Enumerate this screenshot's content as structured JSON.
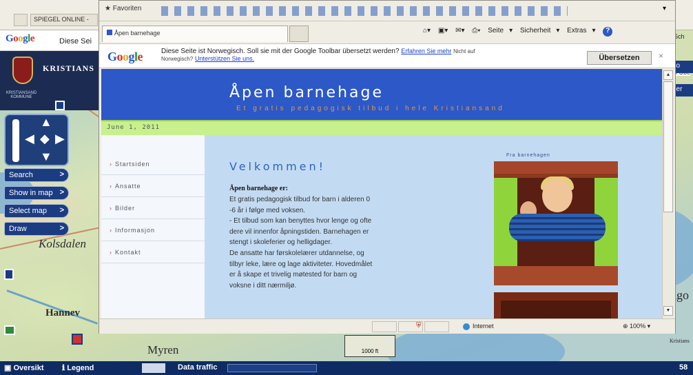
{
  "map_app": {
    "browser_tab_label": "SPIEGEL ONLINE -",
    "google_logo": "Google",
    "google_bar_text": "Diese Sei",
    "municipality_name": "KRISTIANS",
    "municipality_sub": "KRISTIANSAND KOMMUNE",
    "buttons": [
      {
        "label": "Search"
      },
      {
        "label": "Show in map"
      },
      {
        "label": "Select map"
      },
      {
        "label": "Draw"
      }
    ],
    "map_labels": {
      "kolsdalen": "Kolsdalen",
      "hannev": "Hannev",
      "myren": "Myren",
      "scale": "1000 ft",
      "right_lo": "Lo",
      "right_der": "der",
      "right_uber": "h Übe",
      "right_sch": "Sch",
      "right_krista": "Kristians",
      "right_ago": "ago"
    },
    "taskbar": {
      "oversikt": "Oversikt",
      "legend": "Legend",
      "data_traffic": "Data traffic",
      "right_num": "58"
    }
  },
  "popup": {
    "toolbar": {
      "favorites": "Favoriten"
    },
    "tab_title": "Åpen barnehage",
    "commands": {
      "page": "Seite",
      "security": "Sicherheit",
      "extras": "Extras"
    },
    "google_translate": {
      "logo": "Google",
      "message_line1": "Diese Seite ist Norwegisch. Soll sie mit der Google Toolbar übersetzt werden?",
      "learn_more": "Erfahren Sie mehr",
      "not_on": "Nicht auf",
      "message_line2_prefix": "Norwegisch?",
      "support_link": "Unterstützen Sie uns.",
      "translate_button": "Übersetzen",
      "close": "×"
    },
    "site": {
      "title": "Åpen barnehage",
      "tagline": "Et gratis pedagogisk tilbud i hele Kristiansand",
      "date": "June 1, 2011",
      "menu": [
        {
          "label": "Startsiden"
        },
        {
          "label": "Ansatte"
        },
        {
          "label": "Bilder"
        },
        {
          "label": "Informasjon"
        },
        {
          "label": "Kontakt"
        }
      ],
      "welcome": "Velkommen!",
      "intro_heading": "Åpen barnehage er:",
      "intro_lines": [
        "  Et gratis pedagogisk tilbud for barn i alderen 0",
        "-6 år i følge med voksen.",
        "- Et tilbud som kan benyttes hvor lenge og ofte",
        "dere vil innenfor åpningstiden. Barnehagen er",
        "stengt i skoleferier og helligdager.",
        "  De ansatte har førskolelærer utdannelse, og",
        "tilbyr leke, lære og lage aktiviteter. Hovedmålet",
        "er å skape et trivelig møtested for barn og",
        "voksne i ditt nærmiljø."
      ],
      "photo_caption": "Fra barnehagen"
    },
    "status": {
      "zone": "Internet",
      "zoom": "100%"
    }
  }
}
